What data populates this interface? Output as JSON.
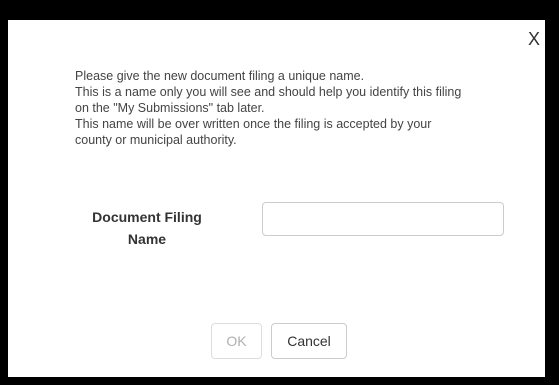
{
  "dialog": {
    "close_label": "X",
    "instructions": [
      "Please give the new document filing a unique name.",
      "This is a name only you will see and should help you identify this filing",
      "on the \"My Submissions\" tab later.",
      "This name will be over written once the filing is accepted by your",
      "county or municipal authority."
    ],
    "field_label_line1": "Document Filing",
    "field_label_line2": "Name",
    "input_value": "",
    "input_placeholder": "",
    "ok_label": "OK",
    "cancel_label": "Cancel",
    "ok_state": "disabled"
  }
}
